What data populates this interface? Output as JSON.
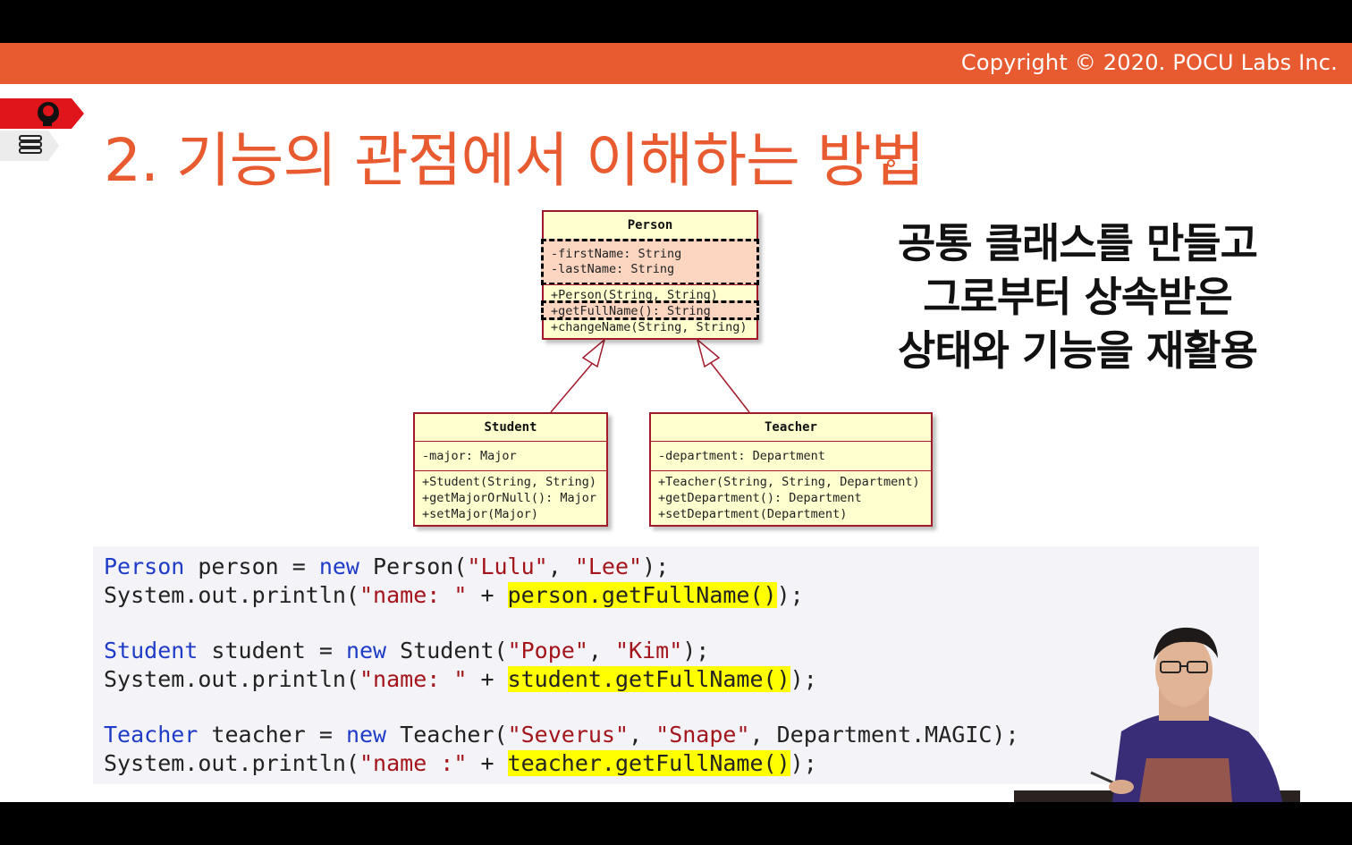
{
  "header": {
    "copyright": "Copyright © 2020. POCU Labs Inc."
  },
  "slide": {
    "title": "2. 기능의 관점에서 이해하는 방법"
  },
  "nav": {
    "tab1_icon": "brain-icon",
    "tab2_icon": "book-stack-icon"
  },
  "uml": {
    "person": {
      "name": "Person",
      "attributes": [
        "-firstName: String",
        "-lastName: String"
      ],
      "methods": [
        "+Person(String, String)",
        "+getFullName(): String",
        "+changeName(String, String)"
      ]
    },
    "student": {
      "name": "Student",
      "attributes": [
        "-major: Major"
      ],
      "methods": [
        "+Student(String, String)",
        "+getMajorOrNull(): Major",
        "+setMajor(Major)"
      ]
    },
    "teacher": {
      "name": "Teacher",
      "attributes": [
        "-department: Department"
      ],
      "methods": [
        "+Teacher(String, String, Department)",
        "+getDepartment(): Department",
        "+setDepartment(Department)"
      ]
    }
  },
  "side_text": [
    "공통 클래스를 만들고",
    "그로부터 상속받은",
    "상태와 기능을 재활용"
  ],
  "code": {
    "l1": {
      "type": "Person",
      "rest1": " person = ",
      "kw": "new",
      "rest2": " Person(",
      "s1": "\"Lulu\"",
      "comma": ", ",
      "s2": "\"Lee\"",
      "end": ");"
    },
    "l2": {
      "a": "System.out.println(",
      "s": "\"name: \"",
      "plus": " + ",
      "hl": "person.getFullName()",
      "end": ");"
    },
    "l3": {
      "type": "Student",
      "rest1": " student = ",
      "kw": "new",
      "rest2": " Student(",
      "s1": "\"Pope\"",
      "comma": ", ",
      "s2": "\"Kim\"",
      "end": ");"
    },
    "l4": {
      "a": "System.out.println(",
      "s": "\"name: \"",
      "plus": " + ",
      "hl": "student.getFullName()",
      "end": ");"
    },
    "l5": {
      "type": "Teacher",
      "rest1": " teacher = ",
      "kw": "new",
      "rest2": " Teacher(",
      "s1": "\"Severus\"",
      "comma": ", ",
      "s2": "\"Snape\"",
      "end": ", Department.MAGIC);"
    },
    "l6": {
      "a": "System.out.println(",
      "s": "\"name :\"",
      "plus": " + ",
      "hl": "teacher.getFullName()",
      "end": ");"
    }
  },
  "colors": {
    "accent": "#e85a2f",
    "uml_fill": "#fefecf",
    "uml_border": "#a31a2a",
    "keyword": "#1f3cc7",
    "string": "#a3151a",
    "highlight": "#ffff00"
  }
}
